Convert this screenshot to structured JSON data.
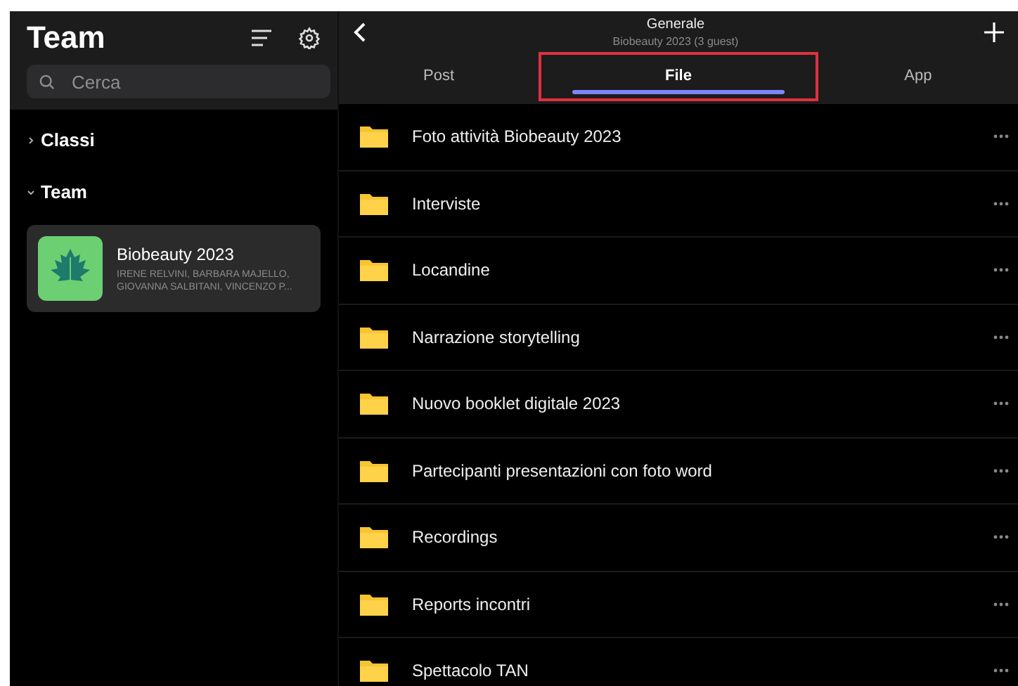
{
  "sidebar": {
    "title": "Team",
    "search": {
      "placeholder": "Cerca"
    },
    "sections": [
      {
        "label": "Classi",
        "expanded": false
      },
      {
        "label": "Team",
        "expanded": true,
        "teams": [
          {
            "name": "Biobeauty 2023",
            "members": "IRENE RELVINI, BARBARA MAJELLO, GIOVANNA SALBITANI, VINCENZO P...",
            "selected": true
          }
        ]
      }
    ]
  },
  "channel": {
    "title": "Generale",
    "subtitle": "Biobeauty 2023 (3 guest)"
  },
  "tabs": [
    {
      "label": "Post",
      "selected": false,
      "highlighted": false
    },
    {
      "label": "File",
      "selected": true,
      "highlighted": true
    },
    {
      "label": "App",
      "selected": false,
      "highlighted": false
    }
  ],
  "files": [
    {
      "name": "Foto attività Biobeauty 2023"
    },
    {
      "name": "Interviste"
    },
    {
      "name": "Locandine"
    },
    {
      "name": "Narrazione storytelling"
    },
    {
      "name": "Nuovo booklet digitale 2023"
    },
    {
      "name": "Partecipanti presentazioni con foto word"
    },
    {
      "name": "Recordings"
    },
    {
      "name": "Reports incontri"
    },
    {
      "name": "Spettacolo TAN"
    }
  ]
}
